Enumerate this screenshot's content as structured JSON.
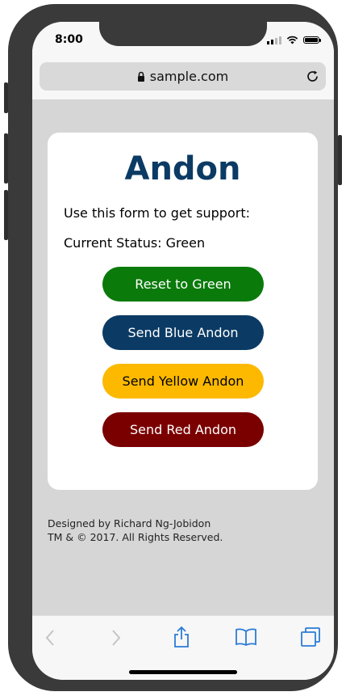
{
  "status_bar": {
    "time": "8:00"
  },
  "browser": {
    "url": "sample.com"
  },
  "page": {
    "title": "Andon",
    "intro": "Use this form to get support:",
    "current_status": "Current Status: Green",
    "buttons": {
      "reset": "Reset to Green",
      "blue": "Send Blue Andon",
      "yellow": "Send Yellow Andon",
      "red": "Send Red Andon"
    }
  },
  "footer": {
    "line1": "Designed by Richard Ng-Jobidon",
    "line2": "TM & © 2017. All Rights Reserved."
  },
  "colors": {
    "title": "#0b3b64",
    "green": "#0a7a0a",
    "blue": "#0b3b64",
    "yellow": "#fcb900",
    "red": "#7a0000",
    "safari_blue": "#2a7bd6"
  },
  "icons": {
    "lock": "lock-icon",
    "reload": "reload-icon",
    "back": "back-icon",
    "forward": "forward-icon",
    "share": "share-icon",
    "bookmarks": "bookmarks-icon",
    "tabs": "tabs-icon"
  }
}
